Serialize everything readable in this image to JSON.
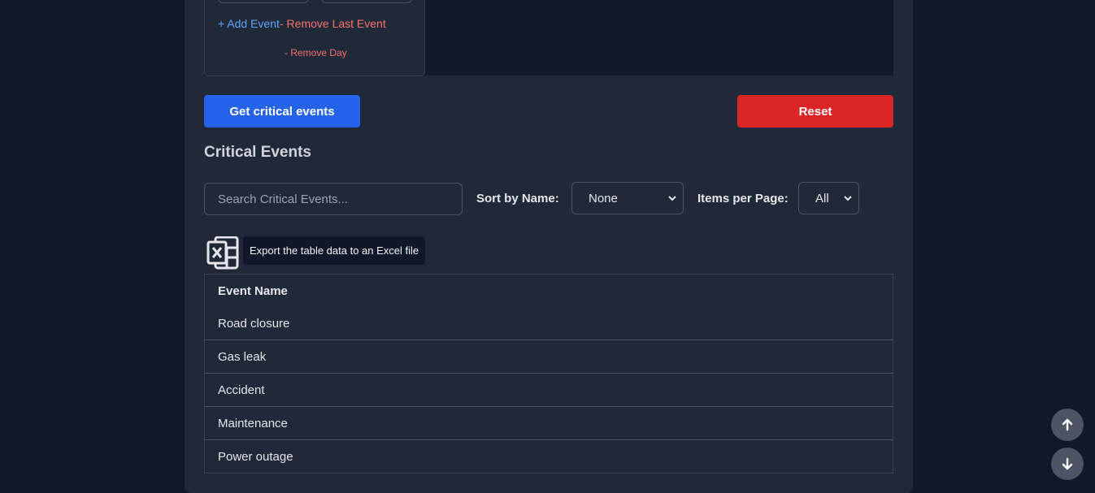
{
  "day_card": {
    "add_event_label": "+ Add Event",
    "remove_last_event_label": "- Remove Last Event",
    "remove_day_label": "- Remove Day"
  },
  "actions": {
    "get_critical_label": "Get critical events",
    "reset_label": "Reset"
  },
  "critical_events": {
    "title": "Critical Events",
    "search_placeholder": "Search Critical Events...",
    "sort_label": "Sort by Name:",
    "sort_value": "None",
    "items_label": "Items per Page:",
    "items_value": "All",
    "export_tooltip": "Export the table data to an Excel file",
    "export_icon": "excel-icon",
    "table": {
      "header": "Event Name",
      "rows": [
        "Road closure",
        "Gas leak",
        "Accident",
        "Maintenance",
        "Power outage"
      ]
    }
  },
  "colors": {
    "page_bg": "#111827",
    "panel_bg": "#1f2937",
    "primary": "#2563eb",
    "danger": "#dc2626",
    "link_blue": "#60a5fa",
    "link_red": "#f87171"
  },
  "scroll": {
    "up_icon": "arrow-up-icon",
    "down_icon": "arrow-down-icon"
  }
}
